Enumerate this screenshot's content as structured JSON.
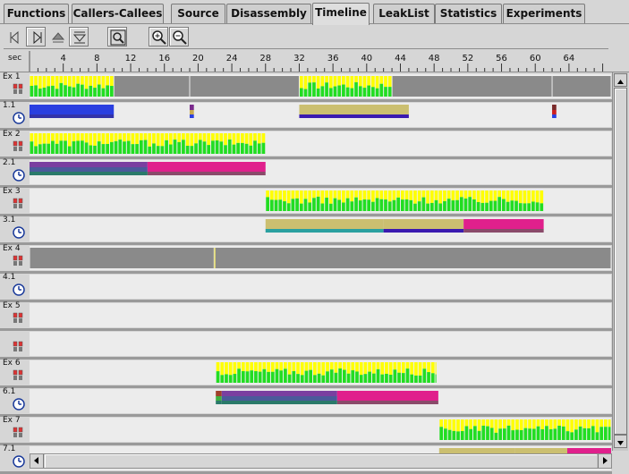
{
  "tabs": [
    "Functions",
    "Callers-Callees",
    "Source",
    "Disassembly",
    "Timeline",
    "LeakList",
    "Statistics",
    "Experiments"
  ],
  "active_tab": "Timeline",
  "toolbar": {
    "buttons": [
      "step-back-icon",
      "step-forward-icon",
      "step-up-icon",
      "step-down-icon",
      "zoom-fit-icon",
      "zoom-in-icon",
      "zoom-out-icon"
    ]
  },
  "ruler": {
    "unit_label": "sec",
    "ticks": [
      "4",
      "8",
      "12",
      "16",
      "20",
      "24",
      "28",
      "32",
      "36",
      "40",
      "44",
      "48",
      "52",
      "56",
      "60",
      "64"
    ]
  },
  "timeline": {
    "time_range": [
      0,
      69
    ],
    "experiments": [
      {
        "label": "Ex 1",
        "thread_label": "1.1",
        "samples": [
          [
            0,
            10
          ],
          [
            32,
            43
          ]
        ],
        "idle": [
          [
            10,
            19
          ],
          [
            19,
            32
          ],
          [
            43,
            62
          ],
          [
            62,
            69
          ]
        ],
        "thread_bars": [
          {
            "start": 0,
            "end": 10,
            "colors": [
              "#2a3fe0",
              "#2a3fe0",
              "#3333aa"
            ]
          },
          {
            "start": 19,
            "end": 19.5,
            "colors": [
              "#7a2a8c",
              "#c8aa50",
              "#2a3fe0"
            ]
          },
          {
            "start": 32,
            "end": 45,
            "colors": [
              "#cbbf70",
              "#cbbf70",
              "#3a1ab0"
            ]
          },
          {
            "start": 62,
            "end": 62.5,
            "colors": [
              "#7a2a2a",
              "#cc2020",
              "#2a3fe0"
            ]
          }
        ]
      },
      {
        "label": "Ex 2",
        "thread_label": "2.1",
        "samples": [
          [
            0,
            28
          ]
        ],
        "idle": [],
        "thread_bars": [
          {
            "start": 0,
            "end": 14,
            "colors": [
              "#7a3fa0",
              "#4a5a9a",
              "#2a7a6a"
            ]
          },
          {
            "start": 14,
            "end": 28,
            "colors": [
              "#e0208c",
              "#e0208c",
              "#8a4a6a"
            ]
          }
        ]
      },
      {
        "label": "Ex 3",
        "thread_label": "3.1",
        "samples": [
          [
            28,
            61
          ]
        ],
        "idle": [],
        "thread_bars": [
          {
            "start": 28,
            "end": 42,
            "colors": [
              "#cbbf70",
              "#cbbf70",
              "#2aa0a0"
            ]
          },
          {
            "start": 42,
            "end": 51.5,
            "colors": [
              "#cbbf70",
              "#cbbf70",
              "#3a1ab0"
            ]
          },
          {
            "start": 51.5,
            "end": 61,
            "colors": [
              "#e0208c",
              "#e0208c",
              "#8a4a6a"
            ]
          }
        ]
      },
      {
        "label": "Ex 4",
        "thread_label": "4.1",
        "samples": [],
        "idle": [
          [
            0,
            21.9
          ],
          [
            21.9,
            69
          ]
        ],
        "marks": [
          {
            "t": 21.9,
            "color": "#e8e070"
          }
        ],
        "thread_bars": []
      },
      {
        "label": "Ex 5",
        "thread_label": "",
        "samples": [],
        "idle": [],
        "thread_bars": []
      },
      {
        "label": "Ex 6",
        "thread_label": "6.1",
        "samples": [
          [
            22.1,
            48.2
          ]
        ],
        "idle": [],
        "thread_bars": [
          {
            "start": 22.1,
            "end": 22.8,
            "colors": [
              "#a0402a",
              "#40b040",
              "#2a7a6a"
            ]
          },
          {
            "start": 22.8,
            "end": 36.5,
            "colors": [
              "#7a3fa0",
              "#4a5a9a",
              "#2a7a6a"
            ]
          },
          {
            "start": 36.5,
            "end": 48.5,
            "colors": [
              "#e0208c",
              "#e0208c",
              "#8a4a6a"
            ]
          }
        ]
      },
      {
        "label": "Ex 7",
        "thread_label": "7.1",
        "samples": [
          [
            48.6,
            69
          ]
        ],
        "idle": [],
        "thread_bars": [
          {
            "start": 48.6,
            "end": 57.6,
            "colors": [
              "#cbbf70",
              "#cbbf70",
              "#2aa0a0"
            ]
          },
          {
            "start": 57.6,
            "end": 63.8,
            "colors": [
              "#cbbf70",
              "#cbbf70",
              "#3a1ab0"
            ]
          },
          {
            "start": 63.8,
            "end": 69,
            "colors": [
              "#e0208c",
              "#e0208c",
              "#8a4a6a"
            ]
          }
        ]
      }
    ]
  },
  "colors": {
    "cpu_user": "#22dd22",
    "cpu_system": "#ffff00",
    "idle": "#8a8a8a",
    "lane_bg": "#ececec",
    "tick_color": "#333333"
  }
}
